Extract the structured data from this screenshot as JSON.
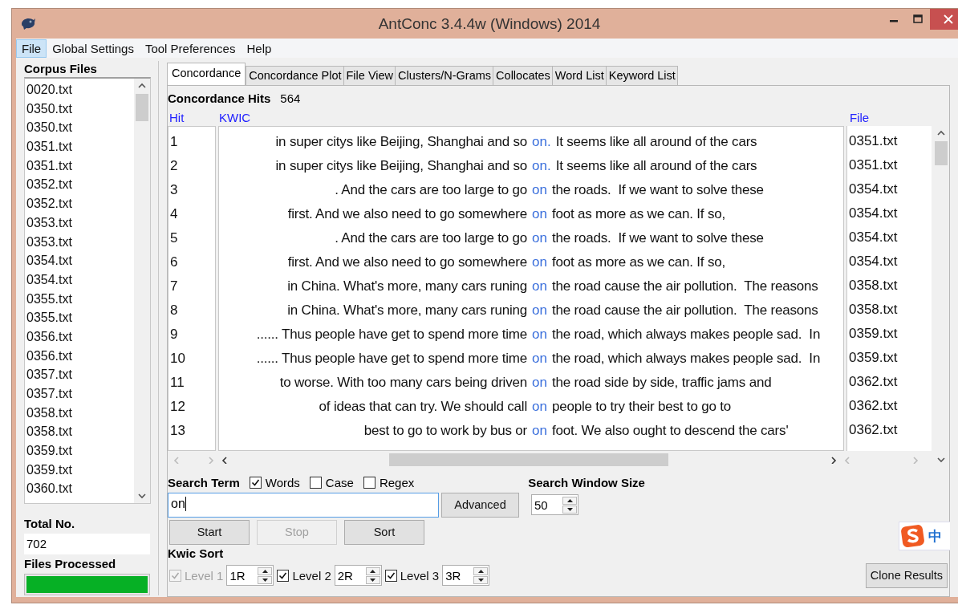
{
  "window": {
    "title": "AntConc 3.4.4w (Windows) 2014"
  },
  "menu": [
    {
      "label": "File",
      "selected": true
    },
    {
      "label": "Global Settings",
      "selected": false
    },
    {
      "label": "Tool Preferences",
      "selected": false
    },
    {
      "label": "Help",
      "selected": false
    }
  ],
  "corpus_files": {
    "title": "Corpus Files",
    "items": [
      "0020.txt",
      "0350.txt",
      "0350.txt",
      "0351.txt",
      "0351.txt",
      "0352.txt",
      "0352.txt",
      "0353.txt",
      "0353.txt",
      "0354.txt",
      "0354.txt",
      "0355.txt",
      "0355.txt",
      "0356.txt",
      "0356.txt",
      "0357.txt",
      "0357.txt",
      "0358.txt",
      "0358.txt",
      "0359.txt",
      "0359.txt",
      "0360.txt"
    ],
    "total_label": "Total No.",
    "total": "702",
    "processed": {
      "label": "Files Processed",
      "level": 1
    }
  },
  "tabs": [
    {
      "label": "Concordance",
      "selected": true
    },
    {
      "label": "Concordance Plot",
      "selected": false
    },
    {
      "label": "File View",
      "selected": false
    },
    {
      "label": "Clusters/N-Grams",
      "selected": false
    },
    {
      "label": "Collocates",
      "selected": false
    },
    {
      "label": "Word List",
      "selected": false
    },
    {
      "label": "Keyword List",
      "selected": false
    }
  ],
  "hits": {
    "label": "Concordance Hits",
    "value": "564"
  },
  "table": {
    "columns": [
      "Hit",
      "KWIC",
      "File"
    ],
    "rows": [
      {
        "hit": "1",
        "left": "in super citys like Beijing, Shanghai and so",
        "keyword": "on.",
        "right": "It seems like all around of the cars",
        "file": "0351.txt"
      },
      {
        "hit": "2",
        "left": "in super citys like Beijing, Shanghai and so",
        "keyword": "on.",
        "right": "It seems like all around of the cars",
        "file": "0351.txt"
      },
      {
        "hit": "3",
        "left": ". And the cars are too large to go",
        "keyword": "on",
        "right": "the roads.  If we want to solve these",
        "file": "0354.txt"
      },
      {
        "hit": "4",
        "left": "first. And we also need to go somewhere",
        "keyword": "on",
        "right": "foot as more as we can. If so,",
        "file": "0354.txt"
      },
      {
        "hit": "5",
        "left": ". And the cars are too large to go",
        "keyword": "on",
        "right": "the roads.  If we want to solve these",
        "file": "0354.txt"
      },
      {
        "hit": "6",
        "left": "first. And we also need to go somewhere",
        "keyword": "on",
        "right": "foot as more as we can. If so,",
        "file": "0354.txt"
      },
      {
        "hit": "7",
        "left": "in China. What's more, many cars runing",
        "keyword": "on",
        "right": "the road cause the air pollution.  The reasons",
        "file": "0358.txt"
      },
      {
        "hit": "8",
        "left": "in China. What's more, many cars runing",
        "keyword": "on",
        "right": "the road cause the air pollution.  The reasons",
        "file": "0358.txt"
      },
      {
        "hit": "9",
        "left": "...... Thus people have get to spend more time",
        "keyword": "on",
        "right": "the road, which always makes people sad.  In",
        "file": "0359.txt"
      },
      {
        "hit": "10",
        "left": "...... Thus people have get to spend more time",
        "keyword": "on",
        "right": "the road, which always makes people sad.  In",
        "file": "0359.txt"
      },
      {
        "hit": "11",
        "left": "to worse. With too many cars being driven",
        "keyword": "on",
        "right": "the road side by side, traffic jams and",
        "file": "0362.txt"
      },
      {
        "hit": "12",
        "left": "of ideas that can try. We should call",
        "keyword": "on",
        "right": "people to try their best to go to",
        "file": "0362.txt"
      },
      {
        "hit": "13",
        "left": "best to go to work by bus or",
        "keyword": "on",
        "right": "foot. We also ought to descend the cars'",
        "file": "0362.txt"
      }
    ]
  },
  "search": {
    "label": "Search Term",
    "options": [
      {
        "label": "Words",
        "checked": true
      },
      {
        "label": "Case",
        "checked": false
      },
      {
        "label": "Regex",
        "checked": false
      }
    ],
    "value": "on",
    "advanced": "Advanced",
    "window_label": "Search Window Size",
    "window_size": "50"
  },
  "buttons": [
    {
      "label": "Start",
      "disabled": false
    },
    {
      "label": "Stop",
      "disabled": true
    },
    {
      "label": "Sort",
      "disabled": false
    }
  ],
  "kwic_sort": {
    "label": "Kwic Sort",
    "levels": [
      {
        "label": "Level 1",
        "checked": true,
        "disabled": true,
        "value": "1R"
      },
      {
        "label": "Level 2",
        "checked": true,
        "disabled": false,
        "value": "2R"
      },
      {
        "label": "Level 3",
        "checked": true,
        "disabled": false,
        "value": "3R"
      }
    ]
  },
  "clone": "Clone Results",
  "ime": {
    "label": "中"
  }
}
